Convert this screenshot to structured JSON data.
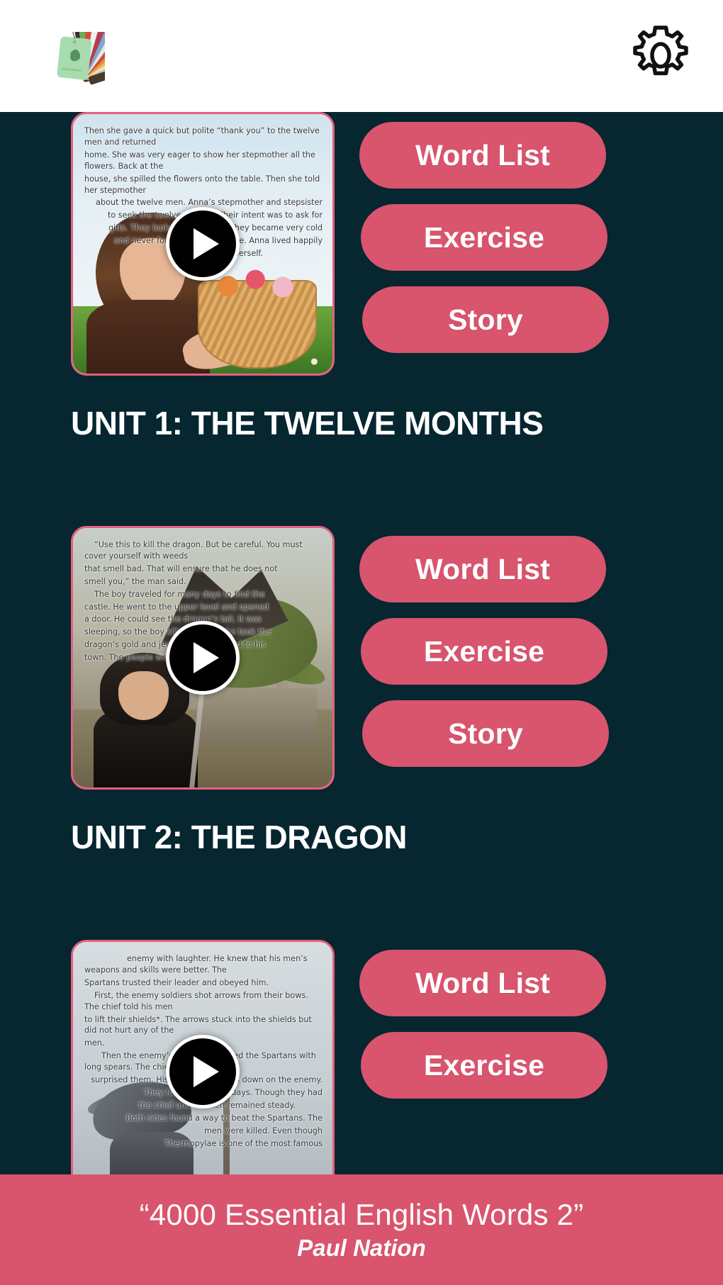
{
  "header": {
    "logo_icon": "color-swatch-fan-logo",
    "settings_icon": "gear-icon"
  },
  "units": [
    {
      "id": "unit-1",
      "title": "UNIT 1: THE TWELVE MONTHS",
      "thumbnail_alt": "girl-holding-flower-basket",
      "play_icon": "play-icon",
      "page_text": [
        "Then she gave a quick but polite “thank you” to the twelve men and returned",
        "home. She was very eager to show her stepmother all the flowers. Back at the",
        "house, she spilled the flowers onto the table. Then she told her stepmother",
        "about the twelve men. Anna’s stepmother and stepsister",
        "to seek the twelve months. Their intent was to ask for",
        "gifts. They looked and looked. They became very cold",
        "and never found their way home. Anna lived happily",
        "by herself."
      ],
      "buttons": [
        {
          "label": "Word List",
          "name": "word-list-button"
        },
        {
          "label": "Exercise",
          "name": "exercise-button"
        },
        {
          "label": "Story",
          "name": "story-button"
        }
      ]
    },
    {
      "id": "unit-2",
      "title": "UNIT 2: THE DRAGON",
      "thumbnail_alt": "boy-with-sword-and-dragon",
      "play_icon": "play-icon",
      "page_text": [
        "“Use this to kill the dragon. But be careful. You must cover yourself with weeds",
        "that smell bad. That will ensure that he does not",
        "smell you,” the man said.",
        "The boy traveled for many days to find the",
        "castle. He went to the upper level and opened",
        "a door. He could see the dragon’s tail. It was",
        "sleeping, so the boy killed it. Then, he took the",
        "dragon’s gold and jewelry and returned to his",
        "town. The people were happy."
      ],
      "buttons": [
        {
          "label": "Word List",
          "name": "word-list-button"
        },
        {
          "label": "Exercise",
          "name": "exercise-button"
        },
        {
          "label": "Story",
          "name": "story-button"
        }
      ]
    },
    {
      "id": "unit-3",
      "title": "",
      "thumbnail_alt": "spartan-warrior-statue",
      "play_icon": "play-icon",
      "page_text": [
        "enemy with laughter. He knew that his men’s weapons and skills were better. The",
        "Spartans trusted their leader and obeyed him.",
        "First, the enemy soldiers shot arrows from their bows. The chief told his men",
        "to lift their shields*. The arrows stuck into the shields but did not hurt any of the",
        "men.",
        "Then the enemy’s soldiers attacked the Spartans with long spears. The chief",
        "surprised them. His troops rolled logs down on the enemy.",
        "They fought for three days. Though they had",
        "the chief and his men remained steady.",
        "Both sides found a way to beat the Spartans. The",
        "men were killed. Even though",
        "Thermopylae is one of the most famous"
      ],
      "buttons": [
        {
          "label": "Word List",
          "name": "word-list-button"
        },
        {
          "label": "Exercise",
          "name": "exercise-button"
        }
      ]
    }
  ],
  "footer": {
    "title": "“4000 Essential English Words 2”",
    "author": "Paul Nation"
  },
  "colors": {
    "background": "#062630",
    "accent": "#d9546d",
    "header_background": "#ffffff",
    "text_on_dark": "#ffffff"
  }
}
